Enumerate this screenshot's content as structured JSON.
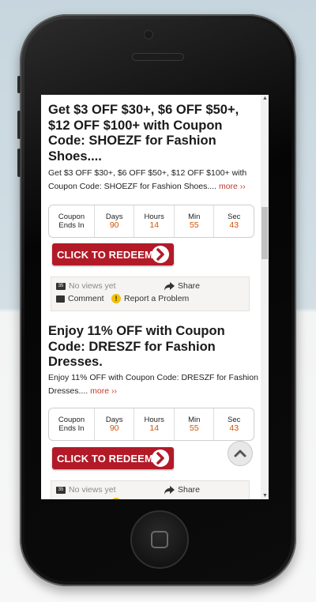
{
  "deals": [
    {
      "title": "Get $3 OFF $30+, $6 OFF $50+, $12 OFF $100+ with Coupon Code: SHOEZF for Fashion Shoes....",
      "desc": "Get $3 OFF $30+, $6 OFF $50+, $12 OFF $100+ with Coupon Code: SHOEZF for Fashion Shoes....",
      "more": "more ››",
      "countdown": {
        "label_line1": "Coupon",
        "label_line2": "Ends In",
        "days_label": "Days",
        "days": "90",
        "hours_label": "Hours",
        "hours": "14",
        "min_label": "Min",
        "min": "55",
        "sec_label": "Sec",
        "sec": "43"
      },
      "redeem": "CLICK TO REDEEM",
      "views_icon": "35",
      "views": "No views yet",
      "share": "Share",
      "comment": "Comment",
      "report": "Report a Problem"
    },
    {
      "title": "Enjoy 11% OFF with Coupon Code: DRESZF for Fashion Dresses.",
      "desc": "Enjoy 11% OFF with Coupon Code: DRESZF for Fashion Dresses....",
      "more": "more ››",
      "countdown": {
        "label_line1": "Coupon",
        "label_line2": "Ends In",
        "days_label": "Days",
        "days": "90",
        "hours_label": "Hours",
        "hours": "14",
        "min_label": "Min",
        "min": "55",
        "sec_label": "Sec",
        "sec": "43"
      },
      "redeem": "CLICK TO REDEEM",
      "views_icon": "35",
      "views": "No views yet",
      "share": "Share"
    }
  ],
  "colors": {
    "redeem": "#b31a28",
    "countdown_value": "#d35400",
    "more_link": "#c0392b"
  },
  "icons": {
    "back_to_top": "chevron-up-icon",
    "redeem_arrow": "chevron-right-icon"
  }
}
